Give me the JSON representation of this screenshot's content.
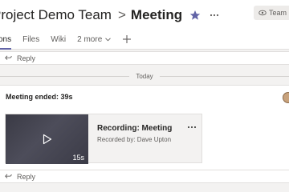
{
  "header": {
    "team_name": "Project Demo Team",
    "separator": ">",
    "channel_name": "Meeting",
    "team_button_label": "Team"
  },
  "tabs": [
    {
      "label": "Posts",
      "visible_label": "tions",
      "active": true
    },
    {
      "label": "Files",
      "active": false
    },
    {
      "label": "Wiki",
      "active": false
    },
    {
      "label": "2 more",
      "active": false
    }
  ],
  "reply_top": {
    "label": "Reply"
  },
  "date_divider": {
    "label": "Today"
  },
  "message": {
    "text": "Meeting ended: 39s",
    "recording": {
      "title": "Recording: Meeting",
      "recorded_by": "Recorded by: Dave Upton",
      "duration": "15s"
    }
  },
  "reply_bottom": {
    "label": "Reply"
  },
  "colors": {
    "accent": "#6264a7",
    "background": "#f3f2f1",
    "surface": "#ffffff"
  },
  "icons": {
    "favorite": "star-icon",
    "more": "more-icon",
    "team": "eye-icon",
    "add_tab": "plus-icon",
    "reply": "reply-arrow-icon",
    "play": "play-icon"
  }
}
